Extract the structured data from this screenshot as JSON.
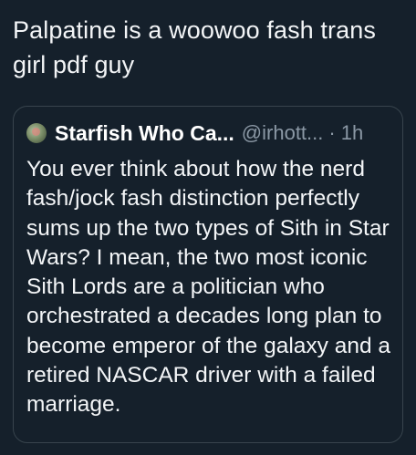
{
  "tweet": {
    "text": "Palpatine is a woowoo fash trans girl pdf guy"
  },
  "quoted_tweet": {
    "author": {
      "display_name": "Starfish Who Ca...",
      "handle": "@irhott...",
      "separator": "·",
      "time": "1h"
    },
    "text": "You ever think about how the nerd fash/jock fash distinction perfectly sums up the two types of Sith in Star Wars? I mean, the two most iconic Sith Lords are a politician who orchestrated a decades long plan to become emperor of the galaxy and a retired NASCAR driver with a failed marriage."
  }
}
